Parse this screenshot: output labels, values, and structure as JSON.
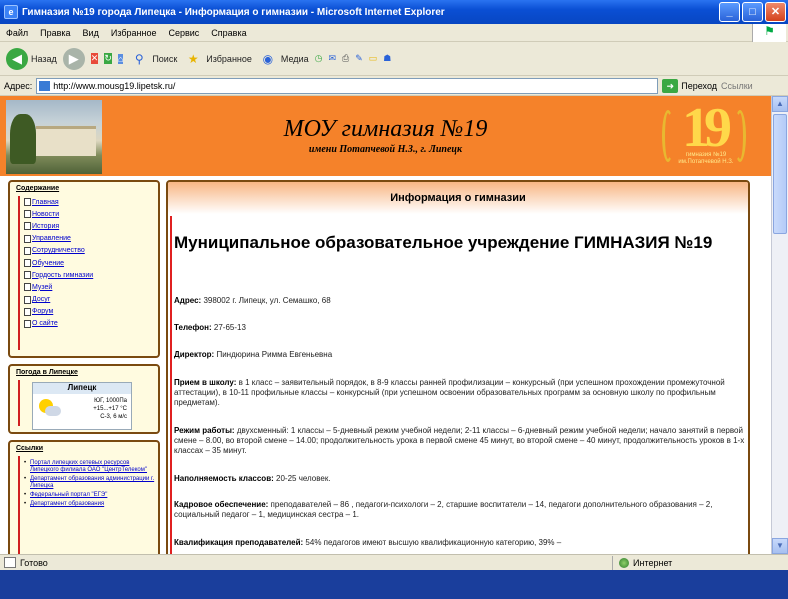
{
  "window": {
    "title": "Гимназия №19 города Липецка - Информация о гимназии - Microsoft Internet Explorer",
    "controls": {
      "minimize": "_",
      "maximize": "□",
      "close": "✕"
    }
  },
  "menu": [
    "Файл",
    "Правка",
    "Вид",
    "Избранное",
    "Сервис",
    "Справка"
  ],
  "toolbar": {
    "back": "Назад",
    "search": "Поиск",
    "favorites": "Избранное",
    "media": "Медиа"
  },
  "address": {
    "label": "Адрес:",
    "url": "http://www.mousg19.lipetsk.ru/",
    "go": "Переход",
    "links": "Ссылки"
  },
  "page": {
    "school_name": "МОУ гимназия №19",
    "school_subtitle": "имени Потапчевой Н.З., г. Липецк",
    "emblem_number": "19",
    "emblem_caption": "гимназия №19 им.Потапчевой Н.З.",
    "sidebar": {
      "contents_title": "Содержание",
      "contents_items": [
        "Главная",
        "Новости",
        "История",
        "Управление",
        "Сотрудничество",
        "Обучение",
        "Гордость гимназии",
        "Музей",
        "Досуг",
        "Форум",
        "О сайте"
      ],
      "weather_title": "Погода в Липецке",
      "weather_city": "Липецк",
      "weather_lines": [
        "ЮГ, 1000Па",
        "+15...+17 °C",
        "С-3, 6 м/с"
      ],
      "links_title": "Ссылки",
      "links_items": [
        "Портал липецких сетевых ресурсов Липецкого филиала ОАО \"ЦентрТелеком\"",
        "Департамент образования администрации г. Липецка",
        "Федеральный портал \"ЕГЭ\"",
        "Департамент образования"
      ]
    },
    "main": {
      "header": "Информация о гимназии",
      "heading": "Муниципальное образовательное учреждение ГИМНАЗИЯ №19",
      "address_label": "Адрес:",
      "address_value": "398002 г. Липецк, ул. Семашко, 68",
      "phone_label": "Телефон:",
      "phone_value": "27-65-13",
      "director_label": "Директор:",
      "director_value": "Пиндюрина Римма Евгеньевна",
      "admission_label": "Прием в школу:",
      "admission_value": "в 1 класс – заявительный порядок, в 8-9 классы ранней профилизации – конкурсный (при успешном прохождении промежуточной аттестации), в 10-11 профильные классы – конкурсный (при успешном освоении образовательных программ за основную школу по профильным предметам).",
      "schedule_label": "Режим работы:",
      "schedule_value": "двухсменный: 1 классы – 5-дневный режим учебной недели; 2-11 классы – 6-дневный режим учебной недели; начало занятий в первой смене – 8.00, во второй смене – 14.00; продолжительность урока в первой смене 45 минут, во второй смене – 40 минут, продолжительность уроков в 1-х классах – 35 минут.",
      "capacity_label": "Наполняемость классов:",
      "capacity_value": "20-25 человек.",
      "staff_label": "Кадровое обеспечение:",
      "staff_value": "преподавателей – 86 , педагоги-психологи – 2, старшие воспитатели – 14, педагоги дополнительного образования – 2, социальный педагог – 1, медицинская сестра – 1.",
      "qual_label": "Квалификация преподавателей:",
      "qual_value": "54% педагогов имеют высшую квалификационную категорию, 39% –"
    }
  },
  "status": {
    "left": "Готово",
    "zone": "Интернет"
  },
  "colors": {
    "banner": "#f5822a",
    "panel_border": "#7a4a10",
    "rule": "#e02020",
    "link": "#0000cc"
  }
}
